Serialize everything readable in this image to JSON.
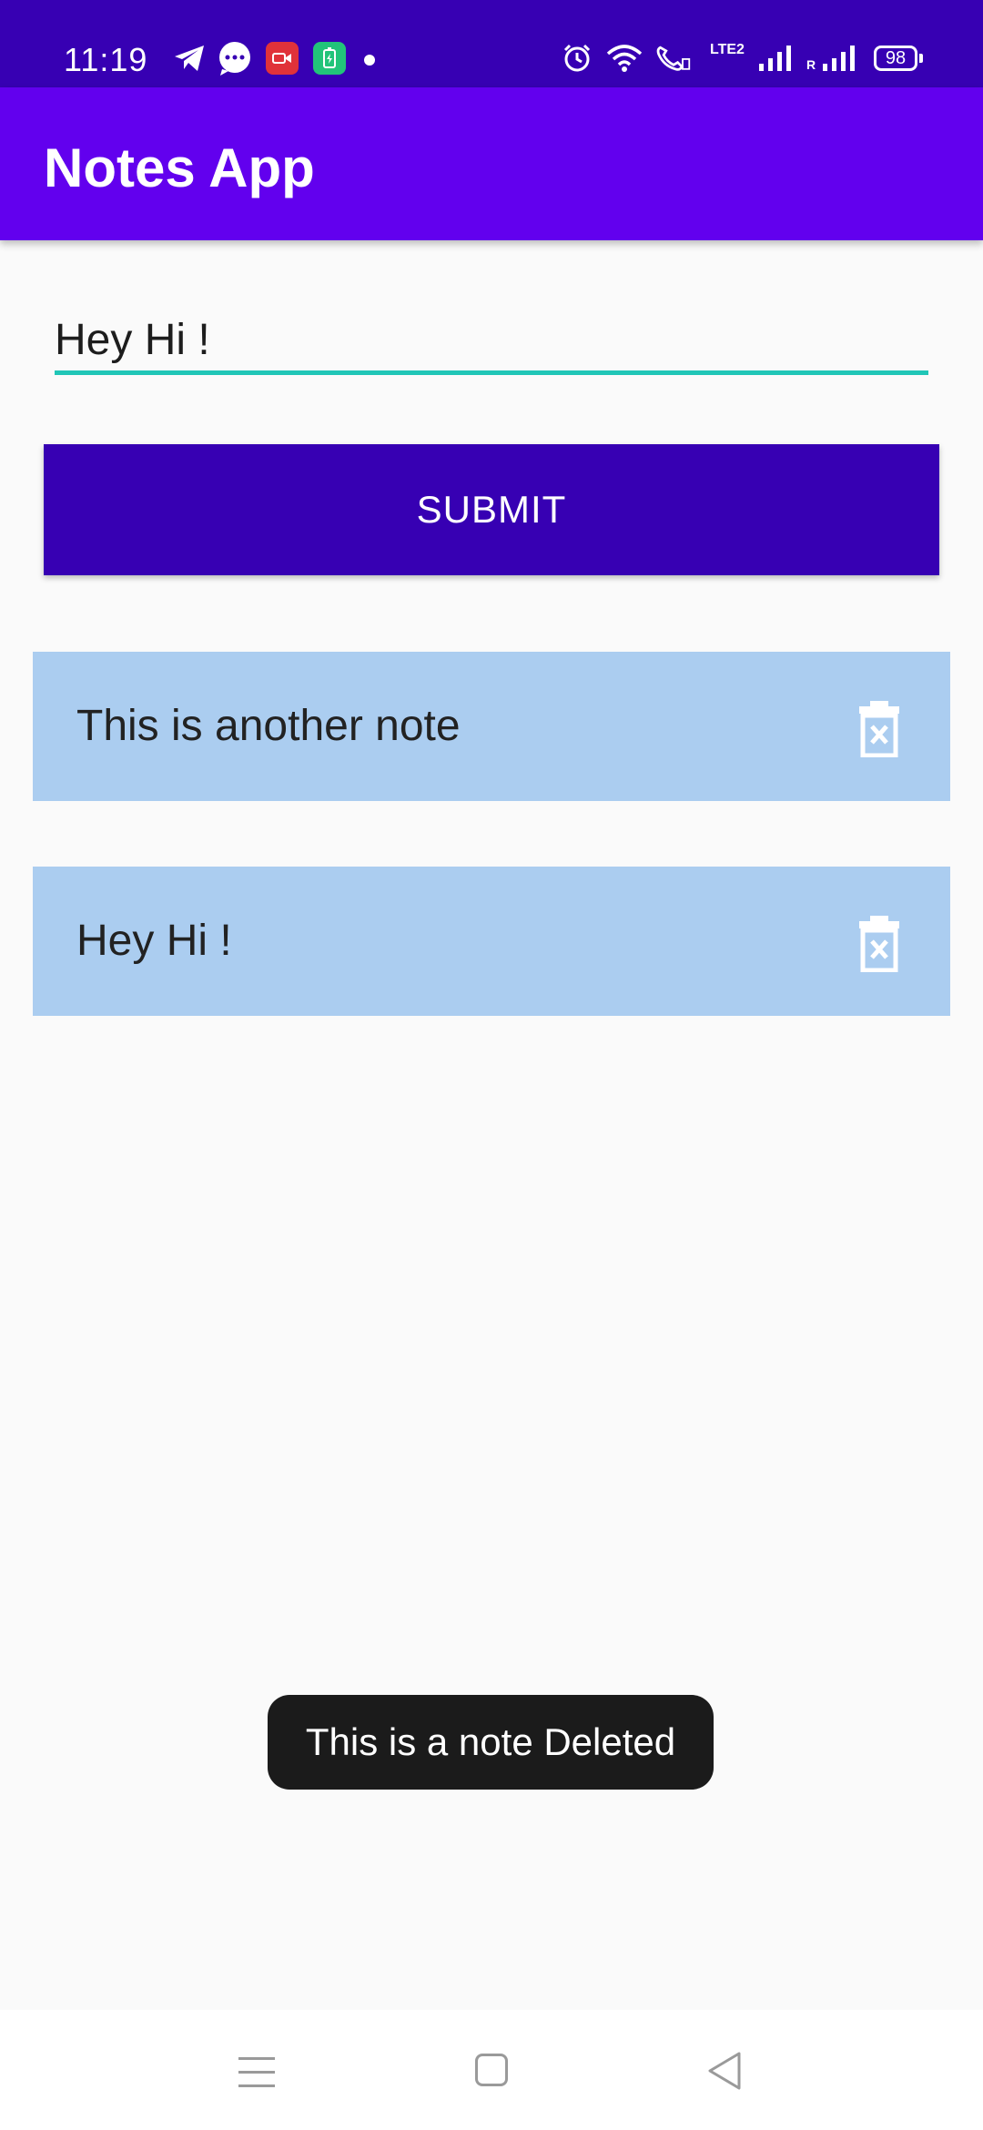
{
  "status_bar": {
    "time": "11:19",
    "battery": "98",
    "network_label": "LTE2",
    "roaming": "R",
    "icons": [
      "telegram-icon",
      "chat-bubble-icon",
      "video-app-icon",
      "battery-app-icon",
      "alarm-icon",
      "wifi-icon",
      "wifi-call-icon",
      "volte-icon",
      "signal-icon",
      "signal-roaming-icon",
      "battery-icon"
    ]
  },
  "app_bar": {
    "title": "Notes App"
  },
  "input": {
    "value": "Hey Hi !"
  },
  "submit_label": "SUBMIT",
  "notes": [
    {
      "text": "This is another note"
    },
    {
      "text": "Hey Hi !"
    }
  ],
  "toast": "This is a note Deleted",
  "colors": {
    "status_bar": "#3700b3",
    "app_bar": "#6200ee",
    "button": "#3700b3",
    "note_card": "#abcdf0",
    "input_underline": "#20c6b7",
    "toast": "#1b1b1b"
  }
}
